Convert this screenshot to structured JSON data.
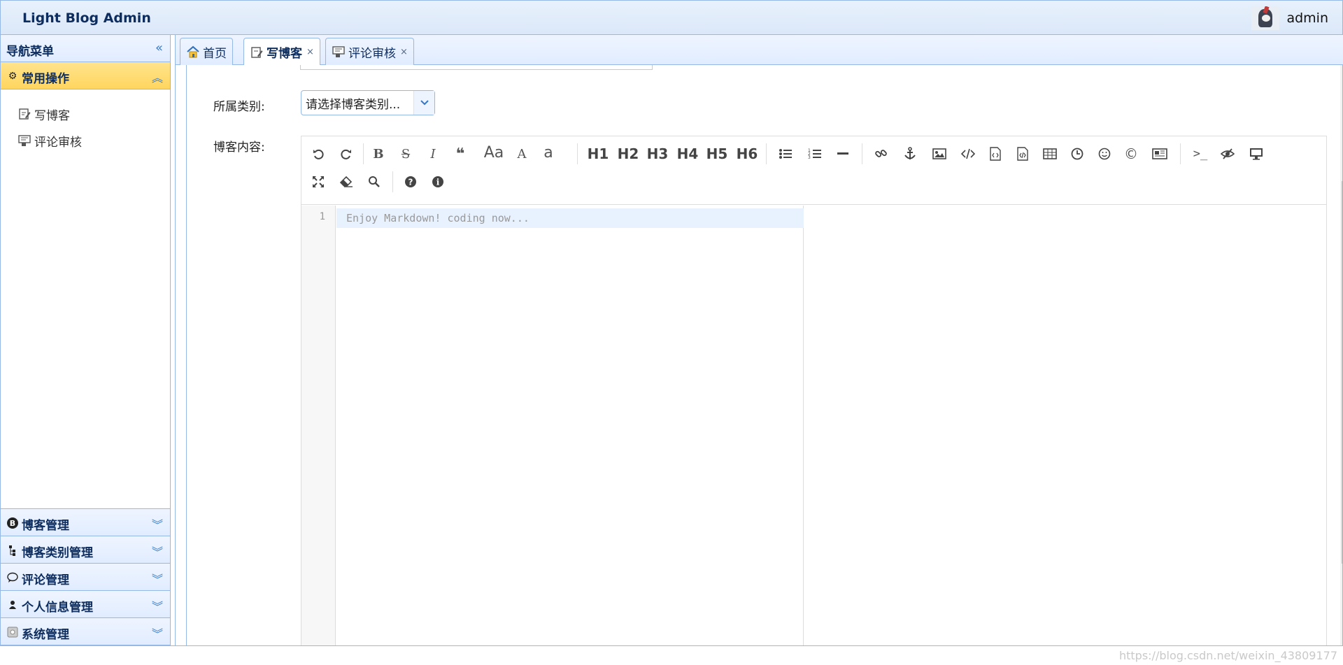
{
  "header": {
    "title": "Light Blog Admin",
    "username": "admin"
  },
  "sidebar": {
    "title": "导航菜单",
    "sections": [
      {
        "label": "常用操作",
        "items": [
          {
            "label": "写博客"
          },
          {
            "label": "评论审核"
          }
        ]
      },
      {
        "label": "博客管理"
      },
      {
        "label": "博客类别管理"
      },
      {
        "label": "评论管理"
      },
      {
        "label": "个人信息管理"
      },
      {
        "label": "系统管理"
      }
    ]
  },
  "tabs": [
    {
      "label": "首页"
    },
    {
      "label": "写博客",
      "close": "×"
    },
    {
      "label": "评论审核",
      "close": "×"
    }
  ],
  "form": {
    "category_label": "所属类别:",
    "category_placeholder": "请选择博客类别...",
    "content_label": "博客内容:"
  },
  "editor": {
    "toolbar_text": {
      "quote": "❝",
      "case": "Aa",
      "upper": "A",
      "lower": "a",
      "h1": "H1",
      "h2": "H2",
      "h3": "H3",
      "h4": "H4",
      "h5": "H5",
      "h6": "H6",
      "terminal": ">_"
    },
    "line_number": "1",
    "placeholder": "Enjoy Markdown! coding now..."
  },
  "watermark": "https://blog.csdn.net/weixin_43809177",
  "colors": {
    "accent": "#95b8e7",
    "active_section": "#ffd55e",
    "brand_text": "#0e2d5f"
  }
}
